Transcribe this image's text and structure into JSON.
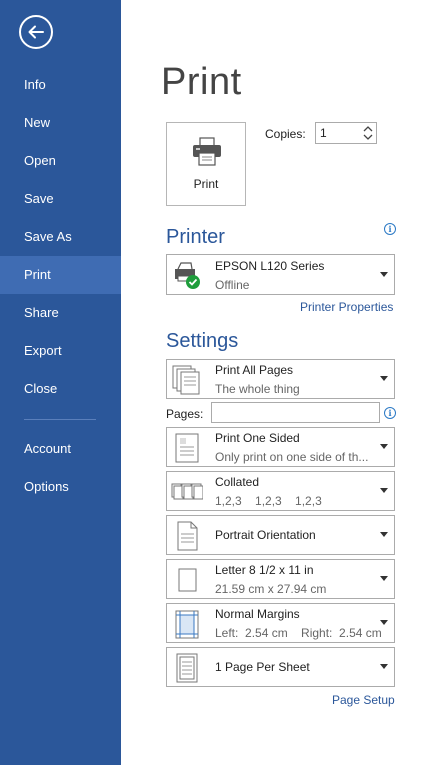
{
  "sidebar": {
    "back_icon": "back-arrow-icon",
    "items": [
      {
        "label": "Info"
      },
      {
        "label": "New"
      },
      {
        "label": "Open"
      },
      {
        "label": "Save"
      },
      {
        "label": "Save As"
      },
      {
        "label": "Print",
        "active": true
      },
      {
        "label": "Share"
      },
      {
        "label": "Export"
      },
      {
        "label": "Close"
      }
    ],
    "bottom_items": [
      {
        "label": "Account"
      },
      {
        "label": "Options"
      }
    ],
    "colors": {
      "background": "#2b579a",
      "active": "#3f6cb3"
    }
  },
  "main": {
    "title": "Print",
    "print_button": {
      "label": "Print",
      "icon": "printer-icon"
    },
    "copies": {
      "label": "Copies:",
      "value": "1"
    },
    "printer": {
      "section_title": "Printer",
      "name": "EPSON L120 Series",
      "status": "Offline",
      "properties_link": "Printer Properties"
    },
    "settings": {
      "section_title": "Settings",
      "print_range": {
        "title": "Print All Pages",
        "subtitle": "The whole thing"
      },
      "pages": {
        "label": "Pages:",
        "value": ""
      },
      "sides": {
        "title": "Print One Sided",
        "subtitle": "Only print on one side of th..."
      },
      "collation": {
        "title": "Collated",
        "subtitle": "1,2,3    1,2,3    1,2,3"
      },
      "orientation": {
        "title": "Portrait Orientation"
      },
      "paper": {
        "title": "Letter 8 1/2 x 11 in",
        "subtitle": "21.59 cm x 27.94 cm"
      },
      "margins": {
        "title": "Normal Margins",
        "subtitle": "Left:  2.54 cm    Right:  2.54 cm"
      },
      "pages_per_sheet": {
        "title": "1 Page Per Sheet"
      },
      "page_setup_link": "Page Setup"
    },
    "colors": {
      "accent": "#2b579a",
      "info": "#2b79c5"
    }
  }
}
